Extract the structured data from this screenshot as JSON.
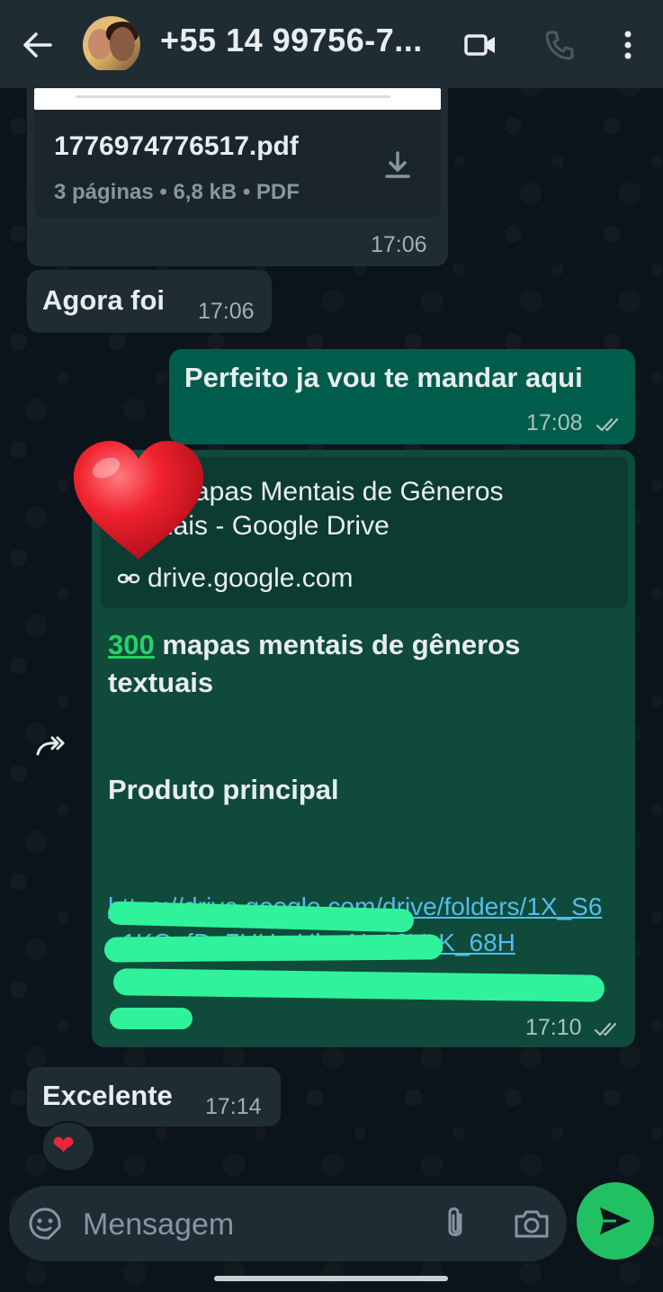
{
  "header": {
    "contact_name": "+55 14 99756-7...",
    "back_icon": "arrow-left-icon",
    "video_icon": "video-camera-icon",
    "call_icon": "phone-icon",
    "more_icon": "more-vertical-icon"
  },
  "messages": {
    "document": {
      "file_name": "1776974776517.pdf",
      "meta": "3 páginas • 6,8 kB • PDF",
      "time": "17:06"
    },
    "agora": {
      "text": "Agora foi",
      "time": "17:06"
    },
    "perfeito": {
      "text": "Perfeito ja vou te mandar aqui",
      "time": "17:08"
    },
    "link": {
      "preview_title_line1": "apas Mentais de Gêneros",
      "preview_title_line2": "uais - Google Drive",
      "preview_domain": "drive.google.com",
      "body_number": "300",
      "body_rest": " mapas mentais de gêneros textuais",
      "product": "Produto principal",
      "url": "https://drive.google.com/drive/folders/1X_S6_1KO_fD_7UU...Uk...N_18VzK_68H",
      "time": "17:10"
    },
    "excelente": {
      "text": "Excelente",
      "time": "17:14",
      "reaction": "❤"
    }
  },
  "composer": {
    "placeholder": "Mensagem"
  },
  "colors": {
    "background": "#0b141a",
    "incoming": "#202c33",
    "outgoing": "#005c4b",
    "accent": "#21c063",
    "link": "#53bdeb"
  }
}
